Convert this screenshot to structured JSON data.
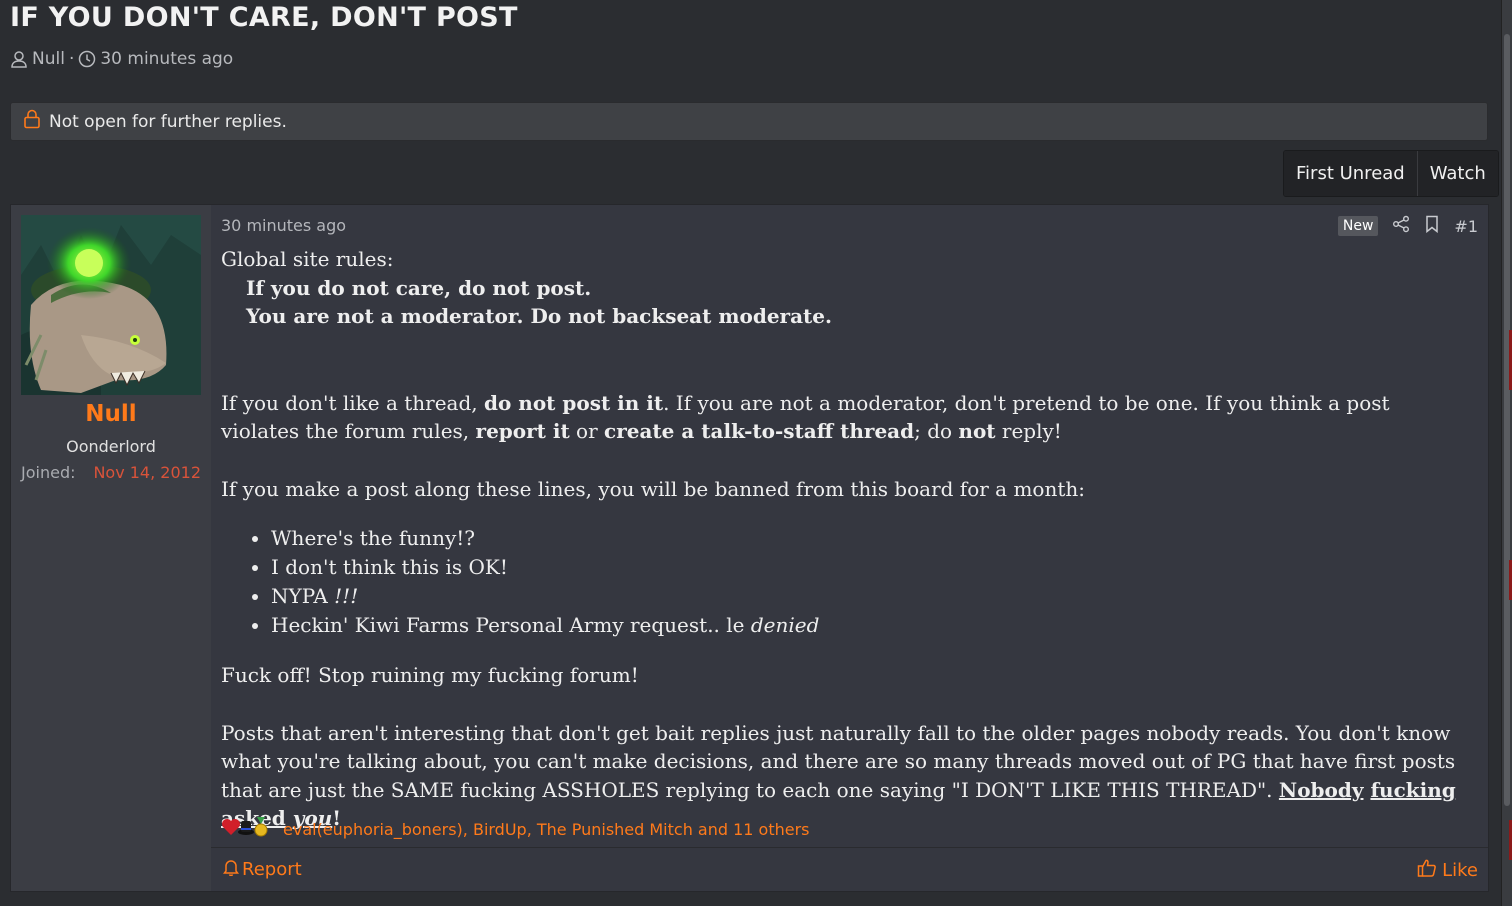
{
  "thread": {
    "title": "IF YOU DON'T CARE, DON'T POST",
    "author": "Null",
    "separator": "·",
    "time": "30 minutes ago"
  },
  "notice": {
    "text": "Not open for further replies."
  },
  "buttons": {
    "first_unread": "First Unread",
    "watch": "Watch"
  },
  "post": {
    "user": {
      "name": "Null",
      "title": "Oonderlord",
      "joined_label": "Joined:",
      "joined_date": "Nov 14, 2012"
    },
    "time": "30 minutes ago",
    "new_badge": "New",
    "number": "#1",
    "content": {
      "intro": "Global site rules:",
      "rule1": "If you do not care, do not post.",
      "rule2": "You are not a moderator. Do not backseat moderate.",
      "p1_a": "If you don't like a thread, ",
      "p1_b": "do not post in it",
      "p1_c": ". If you are not a moderator, don't pretend to be one. If you think a post violates the forum rules, ",
      "p1_d": "report it",
      "p1_e": " or ",
      "p1_f": "create a talk-to-staff thread",
      "p1_g": "; do ",
      "p1_h": "not",
      "p1_i": " reply!",
      "p2": "If you make a post along these lines, you will be banned from this board for a month:",
      "bullets": [
        {
          "text": "Where's the funny!?",
          "emph": ""
        },
        {
          "text": "I don't think this is OK!",
          "emph": ""
        },
        {
          "text": "NYPA ",
          "emph": "!!!"
        },
        {
          "text": "Heckin' Kiwi Farms Personal Army request.. le ",
          "emph": "denied"
        }
      ],
      "p3": "Fuck off! Stop ruining my fucking forum!",
      "p4": "Posts that aren't interesting that don't get bait replies just naturally fall to the older pages nobody reads. You don't know what you're talking about, you can't make decisions, and there are so many threads moved out of PG that have first posts that are just the SAME fucking ASSHOLES replying to each one saying \"I DON'T LIKE THIS THREAD\". ",
      "p4_w1": "Nobody",
      "p4_w2": "fucking",
      "p4_w3": "asked",
      "p4_w4": "you",
      "p4_end": "!"
    },
    "reactions": {
      "text": "eval(euphoria_boners), BirdUp, The Punished Mitch and 11 others",
      "icons": [
        "heart-icon",
        "tophat-icon",
        "medal-icon"
      ]
    },
    "footer": {
      "report": "Report",
      "like": "Like"
    }
  },
  "colors": {
    "accent": "#ff7a1a",
    "joined_date": "#d9533a",
    "background": "#2b2d31"
  }
}
